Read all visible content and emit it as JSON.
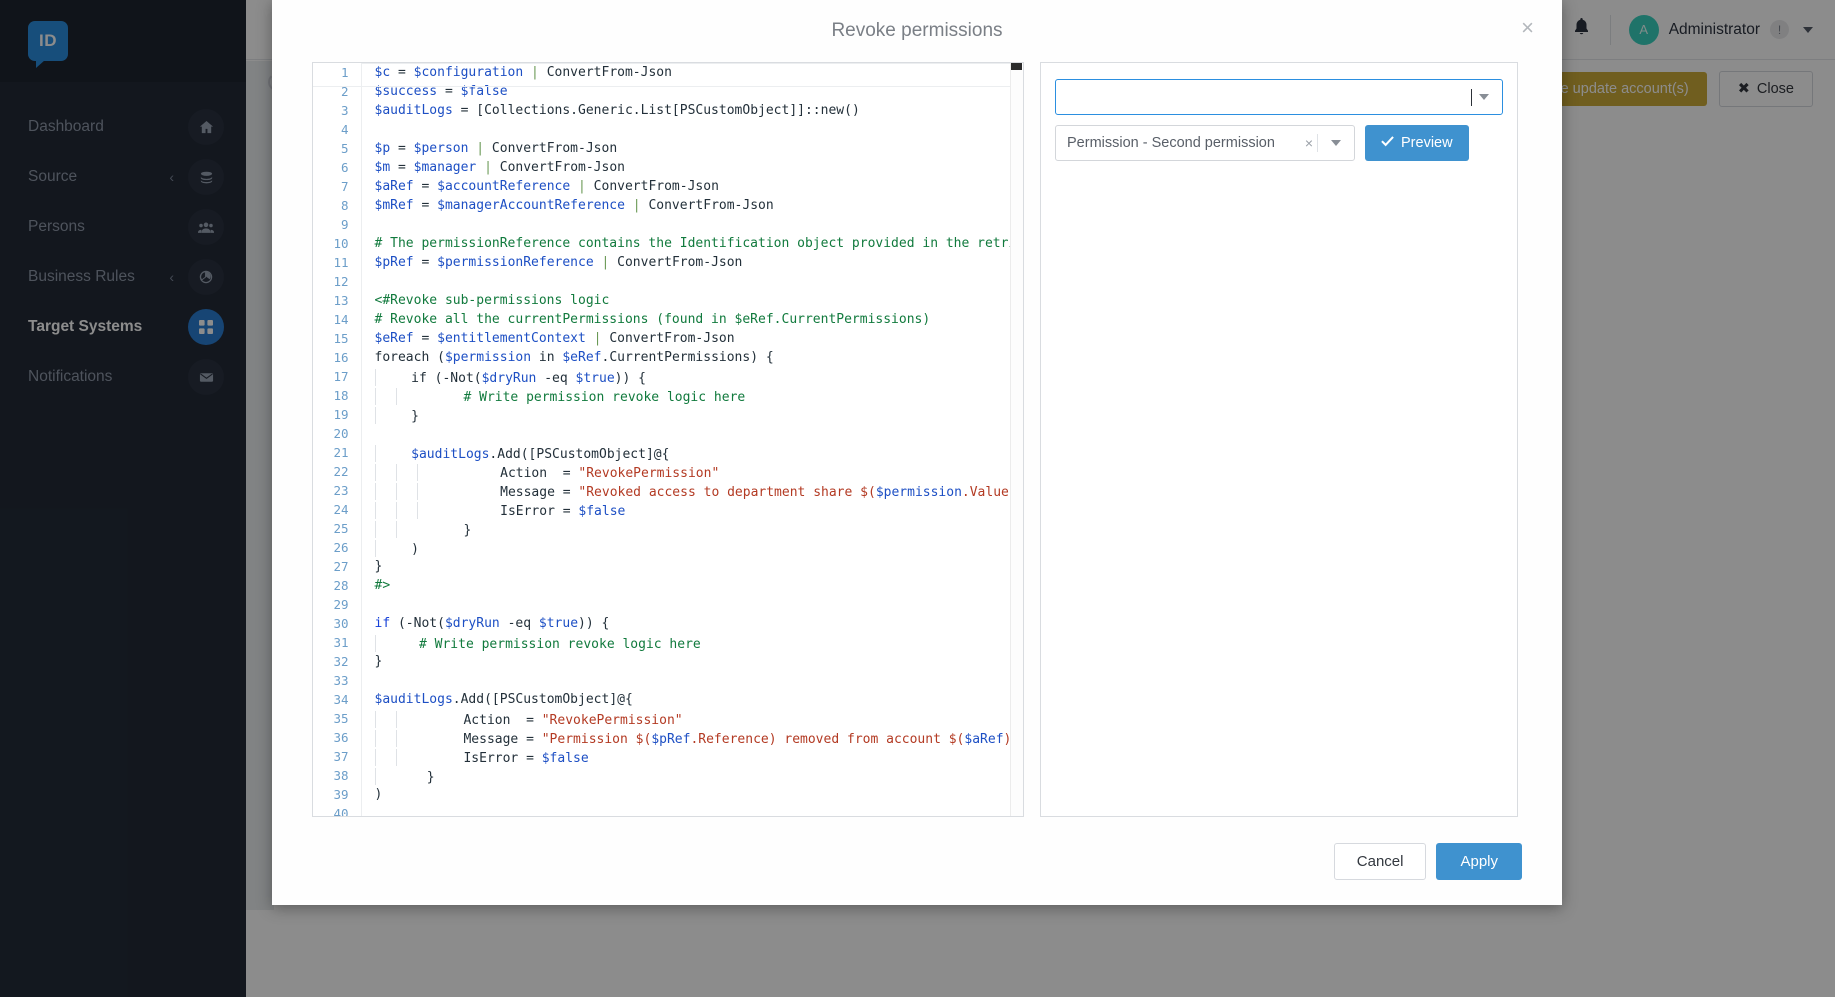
{
  "sidebar": {
    "logo_text": "ID",
    "items": [
      {
        "label": "Dashboard",
        "icon": "home-icon",
        "chevron": "",
        "active": false
      },
      {
        "label": "Source",
        "icon": "layers-icon",
        "chevron": "‹",
        "active": false
      },
      {
        "label": "Persons",
        "icon": "people-icon",
        "chevron": "",
        "active": false
      },
      {
        "label": "Business Rules",
        "icon": "puzzle-icon",
        "chevron": "‹",
        "active": false
      },
      {
        "label": "Target Systems",
        "icon": "grid-icon",
        "chevron": "",
        "active": true
      },
      {
        "label": "Notifications",
        "icon": "envelope-icon",
        "chevron": "",
        "active": false
      }
    ]
  },
  "topbar": {
    "bell_icon": "bell-icon",
    "avatar_initial": "A",
    "user_name": "Administrator",
    "warning_badge": "!",
    "caret_icon": "chevron-down-icon"
  },
  "page_actions": {
    "force_update_label": "rce update account(s)",
    "close_label": "Close",
    "close_icon": "✖"
  },
  "modal": {
    "title": "Revoke permissions",
    "close_icon": "×",
    "footer": {
      "cancel_label": "Cancel",
      "apply_label": "Apply"
    },
    "right_panel": {
      "search_select": {
        "value": "",
        "placeholder": ""
      },
      "permission_select": {
        "value": "Permission - Second permission"
      },
      "preview_button": {
        "label": "Preview",
        "icon": "check-icon"
      }
    }
  },
  "colors": {
    "accent_blue": "#3f92cf",
    "sidebar_bg": "#232b38",
    "active_nav": "#2b7fd4",
    "warning": "#ccab3a",
    "avatar": "#3ad1c0"
  },
  "code": {
    "language": "powershell",
    "lines": [
      {
        "n": 1,
        "indent": 0,
        "tokens": [
          [
            "var",
            "$c"
          ],
          [
            "plain",
            " = "
          ],
          [
            "var",
            "$configuration"
          ],
          [
            "plain",
            " "
          ],
          [
            "pipe",
            "|"
          ],
          [
            "plain",
            " ConvertFrom-Json"
          ]
        ]
      },
      {
        "n": 2,
        "indent": 0,
        "tokens": [
          [
            "var",
            "$success"
          ],
          [
            "plain",
            " = "
          ],
          [
            "var",
            "$false"
          ]
        ]
      },
      {
        "n": 3,
        "indent": 0,
        "tokens": [
          [
            "var",
            "$auditLogs"
          ],
          [
            "plain",
            " = [Collections.Generic.List[PSCustomObject]]::new()"
          ]
        ]
      },
      {
        "n": 4,
        "indent": 0,
        "tokens": []
      },
      {
        "n": 5,
        "indent": 0,
        "tokens": [
          [
            "var",
            "$p"
          ],
          [
            "plain",
            " = "
          ],
          [
            "var",
            "$person"
          ],
          [
            "plain",
            " "
          ],
          [
            "pipe",
            "|"
          ],
          [
            "plain",
            " ConvertFrom-Json"
          ]
        ]
      },
      {
        "n": 6,
        "indent": 0,
        "tokens": [
          [
            "var",
            "$m"
          ],
          [
            "plain",
            " = "
          ],
          [
            "var",
            "$manager"
          ],
          [
            "plain",
            " "
          ],
          [
            "pipe",
            "|"
          ],
          [
            "plain",
            " ConvertFrom-Json"
          ]
        ]
      },
      {
        "n": 7,
        "indent": 0,
        "tokens": [
          [
            "var",
            "$aRef"
          ],
          [
            "plain",
            " = "
          ],
          [
            "var",
            "$accountReference"
          ],
          [
            "plain",
            " "
          ],
          [
            "pipe",
            "|"
          ],
          [
            "plain",
            " ConvertFrom-Json"
          ]
        ]
      },
      {
        "n": 8,
        "indent": 0,
        "tokens": [
          [
            "var",
            "$mRef"
          ],
          [
            "plain",
            " = "
          ],
          [
            "var",
            "$managerAccountReference"
          ],
          [
            "plain",
            " "
          ],
          [
            "pipe",
            "|"
          ],
          [
            "plain",
            " ConvertFrom-Json"
          ]
        ]
      },
      {
        "n": 9,
        "indent": 0,
        "tokens": []
      },
      {
        "n": 10,
        "indent": 0,
        "tokens": [
          [
            "cmt",
            "# The permissionReference contains the Identification object provided in the retriev"
          ]
        ]
      },
      {
        "n": 11,
        "indent": 0,
        "tokens": [
          [
            "var",
            "$pRef"
          ],
          [
            "plain",
            " = "
          ],
          [
            "var",
            "$permissionReference"
          ],
          [
            "plain",
            " "
          ],
          [
            "pipe",
            "|"
          ],
          [
            "plain",
            " ConvertFrom-Json"
          ]
        ]
      },
      {
        "n": 12,
        "indent": 0,
        "tokens": []
      },
      {
        "n": 13,
        "indent": 0,
        "tokens": [
          [
            "cmt",
            "<#Revoke sub-permissions logic"
          ]
        ]
      },
      {
        "n": 14,
        "indent": 0,
        "tokens": [
          [
            "cmt",
            "# Revoke all the currentPermissions (found in $eRef.CurrentPermissions)"
          ]
        ]
      },
      {
        "n": 15,
        "indent": 0,
        "tokens": [
          [
            "var",
            "$eRef"
          ],
          [
            "plain",
            " = "
          ],
          [
            "var",
            "$entitlementContext"
          ],
          [
            "plain",
            " "
          ],
          [
            "pipe",
            "|"
          ],
          [
            "plain",
            " ConvertFrom-Json"
          ]
        ]
      },
      {
        "n": 16,
        "indent": 0,
        "tokens": [
          [
            "plain",
            "foreach ("
          ],
          [
            "var",
            "$permission"
          ],
          [
            "plain",
            " in "
          ],
          [
            "var",
            "$eRef"
          ],
          [
            "plain",
            ".CurrentPermissions) {"
          ]
        ]
      },
      {
        "n": 17,
        "indent": 1,
        "tokens": [
          [
            "plain",
            "  if (-Not("
          ],
          [
            "var",
            "$dryRun"
          ],
          [
            "plain",
            " -eq "
          ],
          [
            "var",
            "$true"
          ],
          [
            "plain",
            ")) {"
          ]
        ]
      },
      {
        "n": 18,
        "indent": 2,
        "tokens": [
          [
            "cmt",
            "      # Write permission revoke logic here"
          ]
        ]
      },
      {
        "n": 19,
        "indent": 1,
        "tokens": [
          [
            "plain",
            "  }"
          ]
        ]
      },
      {
        "n": 20,
        "indent": 0,
        "tokens": []
      },
      {
        "n": 21,
        "indent": 1,
        "tokens": [
          [
            "var",
            "  $auditLogs"
          ],
          [
            "plain",
            ".Add([PSCustomObject]"
          ],
          [
            "plain",
            "@{"
          ]
        ]
      },
      {
        "n": 22,
        "indent": 3,
        "tokens": [
          [
            "plain",
            "        Action  = "
          ],
          [
            "str",
            "\"RevokePermission\""
          ]
        ]
      },
      {
        "n": 23,
        "indent": 3,
        "tokens": [
          [
            "plain",
            "        Message = "
          ],
          [
            "str",
            "\"Revoked access to department share $("
          ],
          [
            "var",
            "$permission"
          ],
          [
            "str",
            ".Value)\""
          ]
        ]
      },
      {
        "n": 24,
        "indent": 3,
        "tokens": [
          [
            "plain",
            "        IsError = "
          ],
          [
            "var",
            "$false"
          ]
        ]
      },
      {
        "n": 25,
        "indent": 2,
        "tokens": [
          [
            "plain",
            "      }"
          ]
        ]
      },
      {
        "n": 26,
        "indent": 1,
        "tokens": [
          [
            "plain",
            "  )"
          ]
        ]
      },
      {
        "n": 27,
        "indent": 0,
        "tokens": [
          [
            "plain",
            "}"
          ]
        ]
      },
      {
        "n": 28,
        "indent": 0,
        "tokens": [
          [
            "cmt",
            "#>"
          ]
        ]
      },
      {
        "n": 29,
        "indent": 0,
        "tokens": []
      },
      {
        "n": 30,
        "indent": 0,
        "tokens": [
          [
            "kw",
            "if"
          ],
          [
            "plain",
            " (-Not("
          ],
          [
            "var",
            "$dryRun"
          ],
          [
            "plain",
            " -eq "
          ],
          [
            "var",
            "$true"
          ],
          [
            "plain",
            ")) {"
          ]
        ]
      },
      {
        "n": 31,
        "indent": 1,
        "tokens": [
          [
            "cmt",
            "   # Write permission revoke logic here"
          ]
        ]
      },
      {
        "n": 32,
        "indent": 0,
        "tokens": [
          [
            "plain",
            "}"
          ]
        ]
      },
      {
        "n": 33,
        "indent": 0,
        "tokens": []
      },
      {
        "n": 34,
        "indent": 0,
        "tokens": [
          [
            "var",
            "$auditLogs"
          ],
          [
            "plain",
            ".Add([PSCustomObject]@{"
          ]
        ]
      },
      {
        "n": 35,
        "indent": 2,
        "tokens": [
          [
            "plain",
            "      Action  = "
          ],
          [
            "str",
            "\"RevokePermission\""
          ]
        ]
      },
      {
        "n": 36,
        "indent": 2,
        "tokens": [
          [
            "plain",
            "      Message = "
          ],
          [
            "str",
            "\"Permission $("
          ],
          [
            "var",
            "$pRef"
          ],
          [
            "str",
            ".Reference) removed from account $("
          ],
          [
            "var",
            "$aRef"
          ],
          [
            "str",
            ")\""
          ]
        ]
      },
      {
        "n": 37,
        "indent": 2,
        "tokens": [
          [
            "plain",
            "      IsError = "
          ],
          [
            "var",
            "$false"
          ]
        ]
      },
      {
        "n": 38,
        "indent": 1,
        "tokens": [
          [
            "plain",
            "    }"
          ]
        ]
      },
      {
        "n": 39,
        "indent": 0,
        "tokens": [
          [
            "plain",
            ")"
          ]
        ]
      },
      {
        "n": 40,
        "indent": 0,
        "tokens": []
      }
    ]
  }
}
